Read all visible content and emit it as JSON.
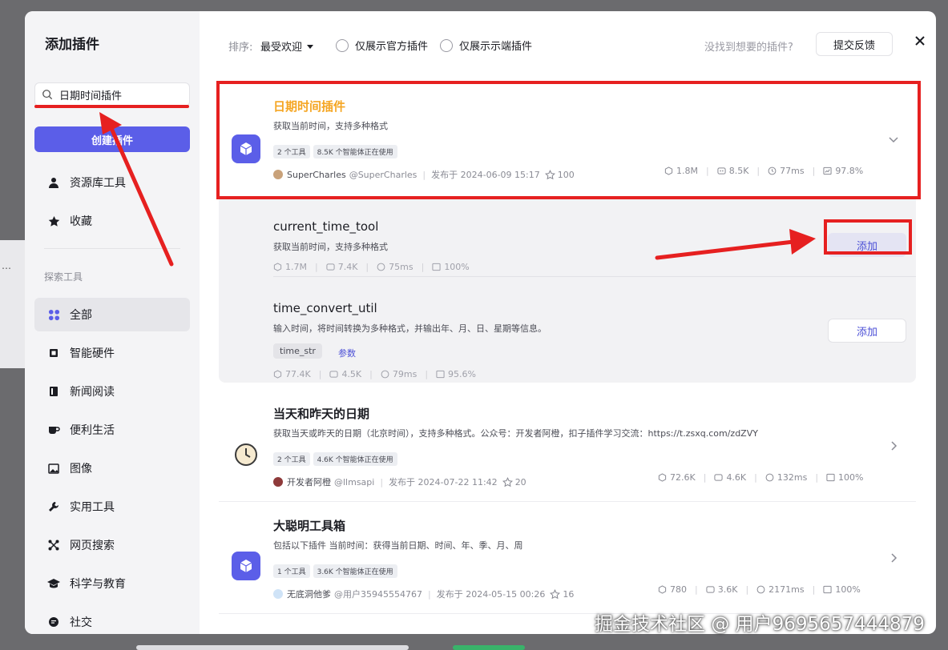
{
  "sidebar": {
    "title": "添加插件",
    "search_value": "日期时间插件",
    "create_button": "创建插件",
    "items": [
      {
        "label": "资源库工具"
      },
      {
        "label": "收藏"
      }
    ],
    "section_label": "探索工具",
    "categories": [
      {
        "label": "全部"
      },
      {
        "label": "智能硬件"
      },
      {
        "label": "新闻阅读"
      },
      {
        "label": "便利生活"
      },
      {
        "label": "图像"
      },
      {
        "label": "实用工具"
      },
      {
        "label": "网页搜索"
      },
      {
        "label": "科学与教育"
      },
      {
        "label": "社交"
      }
    ]
  },
  "topbar": {
    "sort_label": "排序:",
    "sort_value": "最受欢迎",
    "filter_official": "仅展示官方插件",
    "filter_client": "仅展示示端插件",
    "not_found": "没找到想要的插件?",
    "feedback_button": "提交反馈"
  },
  "plugins": [
    {
      "title": "日期时间插件",
      "desc": "获取当前时间，支持多种格式",
      "tags": [
        "2 个工具",
        "8.5K 个智能体正在使用"
      ],
      "author": "SuperCharles",
      "handle": "@SuperCharles",
      "published": "发布于 2024-06-09 15:17",
      "stars": "100",
      "stat_uses": "1.8M",
      "stat_bots": "8.5K",
      "stat_latency": "77ms",
      "stat_success": "97.8%"
    },
    {
      "title": "当天和昨天的日期",
      "desc": "获取当天或昨天的日期（北京时间），支持多种格式。公众号：开发者阿橙，扣子插件学习交流：https://t.zsxq.com/zdZVY",
      "tags": [
        "2 个工具",
        "4.6K 个智能体正在使用"
      ],
      "author": "开发者阿橙",
      "handle": "@llmsapi",
      "published": "发布于 2024-07-22 11:42",
      "stars": "20",
      "stat_uses": "72.6K",
      "stat_bots": "4.6K",
      "stat_latency": "132ms",
      "stat_success": "100%"
    },
    {
      "title": "大聪明工具箱",
      "desc": "包括以下插件 当前时间：获得当前日期、时间、年、季、月、周",
      "tags": [
        "1 个工具",
        "3.6K 个智能体正在使用"
      ],
      "author": "无底洞他爹",
      "handle": "@用户35945554767",
      "published": "发布于 2024-05-15 00:26",
      "stars": "16",
      "stat_uses": "780",
      "stat_bots": "3.6K",
      "stat_latency": "2171ms",
      "stat_success": "100%"
    }
  ],
  "tools": [
    {
      "name": "current_time_tool",
      "desc": "获取当前时间，支持多种格式",
      "stat_uses": "1.7M",
      "stat_bots": "7.4K",
      "stat_latency": "75ms",
      "stat_success": "100%",
      "add_label": "添加"
    },
    {
      "name": "time_convert_util",
      "desc": "输入时间，将时间转换为多种格式，并输出年、月、日、星期等信息。",
      "param": "time_str",
      "param_link": "参数",
      "stat_uses": "77.4K",
      "stat_bots": "4.5K",
      "stat_latency": "79ms",
      "stat_success": "95.6%",
      "add_label": "添加"
    }
  ],
  "watermark": "掘金技术社区 @ 用户9695657444879",
  "colors": {
    "accent": "#5b5ee8",
    "highlight_title": "#f5a623",
    "annotation_red": "#e62020"
  }
}
